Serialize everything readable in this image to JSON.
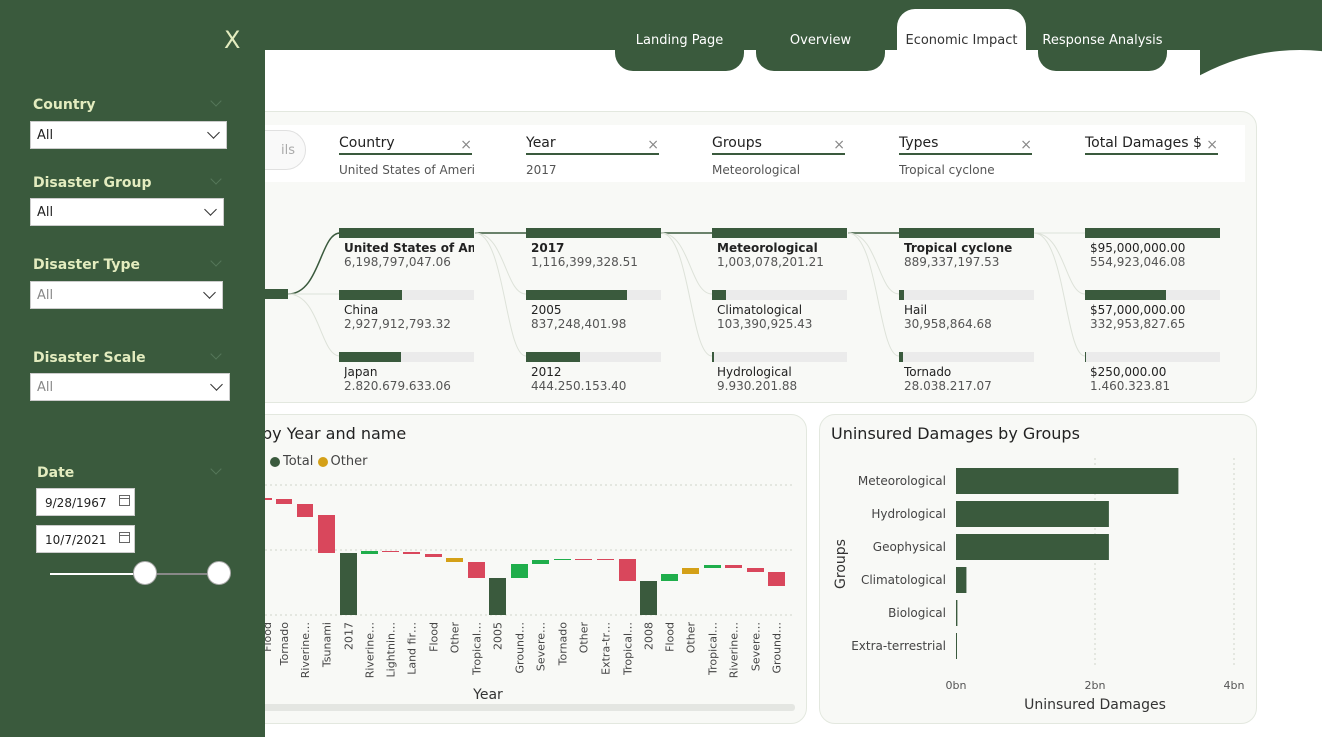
{
  "tabs": [
    {
      "label": "Landing Page",
      "active": false
    },
    {
      "label": "Overview",
      "active": false
    },
    {
      "label": "Economic Impact",
      "active": true
    },
    {
      "label": "Response Analysis",
      "active": false
    }
  ],
  "sidebar": {
    "close_label": "X",
    "filters": [
      {
        "label": "Country",
        "value": "All"
      },
      {
        "label": "Disaster Group",
        "value": "All"
      },
      {
        "label": "Disaster Type",
        "value": "All"
      },
      {
        "label": "Disaster Scale",
        "value": "All"
      }
    ],
    "date": {
      "label": "Date",
      "start": "9/28/1967",
      "end": "10/7/2021",
      "range_start_fraction": 0.56,
      "range_end_fraction": 1.0
    }
  },
  "decomp": {
    "pill_label": "ils",
    "columns": [
      {
        "name": "Country",
        "value": "United States of Ameri…",
        "clear": "×"
      },
      {
        "name": "Year",
        "value": "2017",
        "clear": "×"
      },
      {
        "name": "Groups",
        "value": "Meteorological",
        "clear": "×"
      },
      {
        "name": "Types",
        "value": "Tropical cyclone",
        "clear": "×"
      },
      {
        "name": "Total Damages $",
        "value": "",
        "clear": "×"
      }
    ],
    "levels": [
      [
        {
          "label": "United States of Am…",
          "value": "6,198,797,047.06",
          "fill": 1.0
        },
        {
          "label": "China",
          "value": "2,927,912,793.32",
          "fill": 0.47
        },
        {
          "label": "Japan",
          "value": "2.820.679.633.06",
          "fill": 0.46
        }
      ],
      [
        {
          "label": "2017",
          "value": "1,116,399,328.51",
          "fill": 1.0
        },
        {
          "label": "2005",
          "value": "837,248,401.98",
          "fill": 0.75
        },
        {
          "label": "2012",
          "value": "444.250.153.40",
          "fill": 0.4
        }
      ],
      [
        {
          "label": "Meteorological",
          "value": "1,003,078,201.21",
          "fill": 1.0
        },
        {
          "label": "Climatological",
          "value": "103,390,925.43",
          "fill": 0.1
        },
        {
          "label": "Hydrological",
          "value": "9.930.201.88",
          "fill": 0.015
        }
      ],
      [
        {
          "label": "Tropical cyclone",
          "value": "889,337,197.53",
          "fill": 1.0
        },
        {
          "label": "Hail",
          "value": "30,958,864.68",
          "fill": 0.035
        },
        {
          "label": "Tornado",
          "value": "28.038.217.07",
          "fill": 0.032
        }
      ],
      [
        {
          "label": "$95,000,000.00",
          "value": "554,923,046.08",
          "fill": 1.0
        },
        {
          "label": "$57,000,000.00",
          "value": "332,953,827.65",
          "fill": 0.6
        },
        {
          "label": "$250,000.00",
          "value": "1.460.323.81",
          "fill": 0.003
        }
      ]
    ]
  },
  "waterfall": {
    "title": "by Year and name",
    "legend": [
      {
        "name": "Total",
        "color": "#3a5a3d"
      },
      {
        "name": "Other",
        "color": "#d4a017"
      }
    ],
    "xlabel": "Year",
    "colors": {
      "increase": "#d9475c",
      "decrease": "#1fae4b",
      "total": "#3a5a3d",
      "other": "#d4a017"
    }
  },
  "chart_data": {
    "type": "bar",
    "title": "Uninsured Damages by Groups",
    "xlabel": "Uninsured Damages",
    "ylabel": "Groups",
    "categories": [
      "Meteorological",
      "Hydrological",
      "Geophysical",
      "Climatological",
      "Biological",
      "Extra-terrestrial"
    ],
    "values": [
      3.2,
      2.2,
      2.2,
      0.15,
      0.02,
      0.01
    ],
    "xticks": [
      "0bn",
      "2bn",
      "4bn"
    ],
    "xlim": [
      0,
      4
    ],
    "color": "#3a5a3d"
  }
}
